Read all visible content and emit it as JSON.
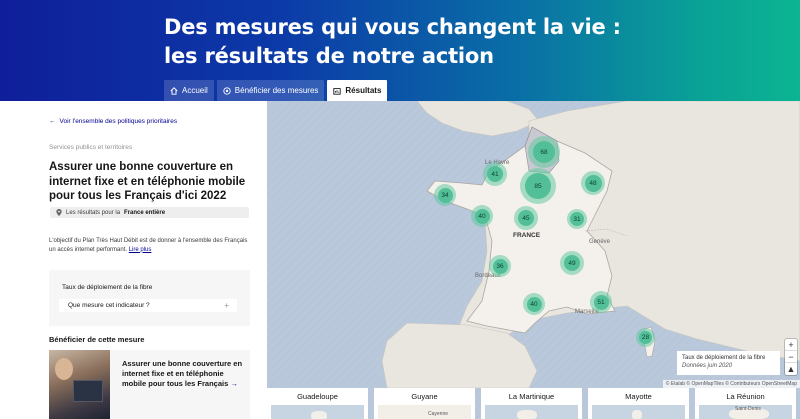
{
  "header": {
    "title": "Des mesures qui vous changent la vie : les résultats de notre action",
    "tabs": [
      {
        "label": "Accueil",
        "icon": "home-icon",
        "active": false
      },
      {
        "label": "Bénéficier des mesures",
        "icon": "target-icon",
        "active": false
      },
      {
        "label": "Résultats",
        "icon": "chart-icon",
        "active": true
      }
    ]
  },
  "left": {
    "back_link": "Voir l'ensemble des politiques prioritaires",
    "category": "Services publics et territoires",
    "measure_title": "Assurer une bonne couverture en internet fixe et en téléphonie mobile pour tous les Français d'ici 2022",
    "location_prefix": "Les résultats pour la",
    "location_value": "France entière",
    "description": "L'objectif du Plan Très Haut Débit est de donner à l'ensemble des Français un accès internet performant.",
    "read_more": "Lire plus",
    "indicator_label": "Taux de déploiement de la fibre",
    "indicator_select": "Que mesure cet indicateur ?",
    "benefit_heading": "Bénéficier de cette mesure",
    "card_title": "Assurer une bonne couverture en internet fixe et en téléphonie mobile pour tous les Français",
    "card_arrow": "→"
  },
  "map": {
    "country_label": "FRANCE",
    "cities": {
      "le_havre": "Le Havre",
      "bordeaux": "Bordeaux",
      "marseille": "Marseille",
      "geneva": "Genève"
    },
    "clusters": [
      {
        "value": "68"
      },
      {
        "value": "41"
      },
      {
        "value": "85"
      },
      {
        "value": "48"
      },
      {
        "value": "34"
      },
      {
        "value": "40"
      },
      {
        "value": "45"
      },
      {
        "value": "31"
      },
      {
        "value": "36"
      },
      {
        "value": "49"
      },
      {
        "value": "40"
      },
      {
        "value": "51"
      },
      {
        "value": "28"
      }
    ],
    "legend_title": "Taux de déploiement de la fibre",
    "legend_sub": "Données juin 2020",
    "attribution": "© Etalab © OpenMapTiles © Contributeurs OpenStreetMap",
    "zoom_in": "+",
    "zoom_out": "−",
    "reset": "▲",
    "overseas": [
      {
        "name": "Guadeloupe"
      },
      {
        "name": "Guyane",
        "place": "Cayenne"
      },
      {
        "name": "La Martinique"
      },
      {
        "name": "Mayotte"
      },
      {
        "name": "La Réunion",
        "place": "Saint-Denis"
      }
    ]
  },
  "colors": {
    "accent": "#000091",
    "cluster": "#52bf98",
    "sea": "#b9c8da",
    "land": "#f2efe9"
  }
}
